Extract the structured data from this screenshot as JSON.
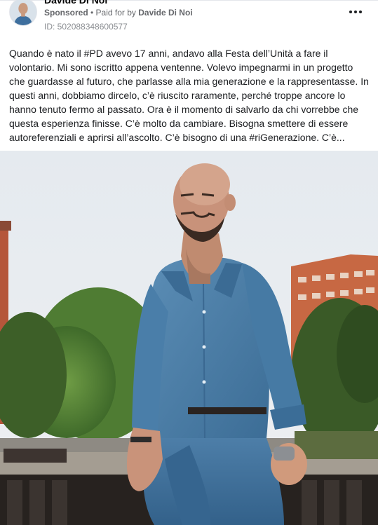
{
  "post": {
    "page_name": "Davide Di Noi",
    "sponsored_label": "Sponsored",
    "separator": " • ",
    "paid_for_label": "Paid for by",
    "payer_name": "Davide Di Noi",
    "library_id": "ID: 502088348600577",
    "more_icon": "more-horizontal-icon",
    "body": "Quando è nato il #PD avevo 17 anni, andavo alla Festa dell’Unità a fare il volontario. Mi sono iscritto appena ventenne. Volevo impegnarmi in un progetto che guardasse al futuro, che parlasse alla mia generazione e la rappresentasse. In questi anni, dobbiamo dircelo, c’è riuscito raramente, perché troppe ancore lo hanno tenuto fermo al passato. Ora è il momento di salvarlo da chi vorrebbe che questa esperienza finisse. C’è molto da cambiare. Bisogna smettere di essere autoreferenziali e aprirsi all’ascolto. C’è bisogno di una #riGenerazione. C’è..."
  },
  "colors": {
    "sky": "#e9edf1",
    "shirt": "#4c7fa8",
    "jeans": "#3f6e98",
    "trees": "#5d8a3c",
    "building": "#c45a35",
    "bench": "#2a2624"
  }
}
